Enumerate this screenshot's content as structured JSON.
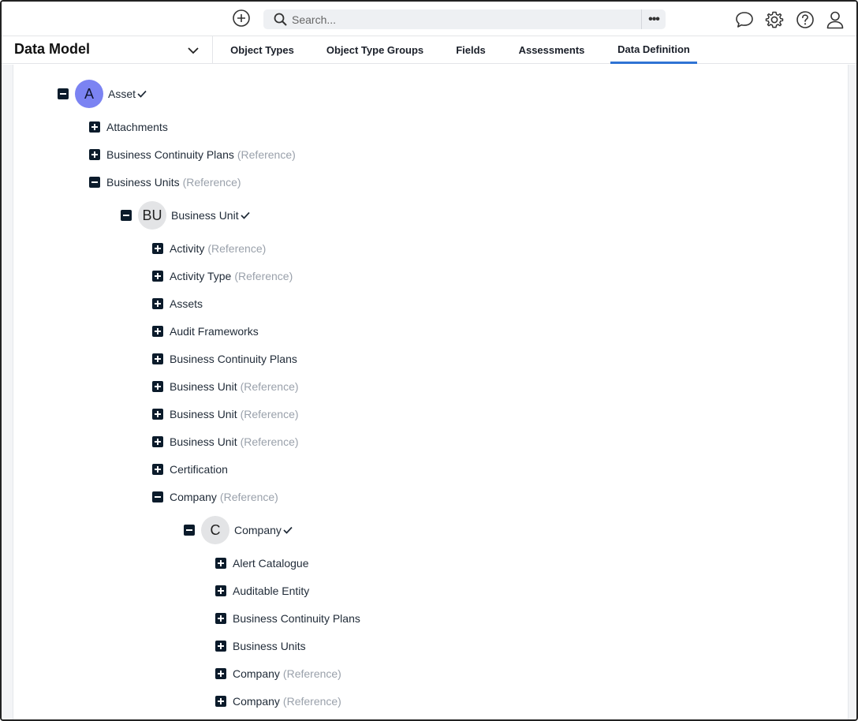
{
  "topbar": {
    "search_placeholder": "Search...",
    "more_label": "•••",
    "icons": [
      "add-circle-icon",
      "search-icon",
      "chat-icon",
      "gear-icon",
      "help-icon",
      "user-icon"
    ]
  },
  "nav": {
    "selector_title": "Data Model",
    "tabs": [
      {
        "label": "Object Types"
      },
      {
        "label": "Object Type Groups"
      },
      {
        "label": "Fields"
      },
      {
        "label": "Assessments"
      },
      {
        "label": "Data Definition",
        "active": true
      }
    ]
  },
  "colors": {
    "accent": "#2f73d4",
    "avatar_primary": "#7b83f2",
    "avatar_secondary": "#e3e4e6",
    "toggle": "#0b1b2b",
    "reference_text": "#9aa1ab"
  },
  "tree": {
    "root": {
      "initials": "A",
      "name": "Asset"
    },
    "level1": [
      {
        "label": "Attachments",
        "ref": "",
        "expanded": false
      },
      {
        "label": "Business Continuity Plans",
        "ref": "(Reference)",
        "expanded": false
      },
      {
        "label": "Business Units",
        "ref": "(Reference)",
        "expanded": true
      }
    ],
    "node2": {
      "initials": "BU",
      "name": "Business Unit"
    },
    "level2": [
      {
        "label": "Activity",
        "ref": "(Reference)",
        "expanded": false
      },
      {
        "label": "Activity Type",
        "ref": "(Reference)",
        "expanded": false
      },
      {
        "label": "Assets",
        "ref": "",
        "expanded": false
      },
      {
        "label": "Audit Frameworks",
        "ref": "",
        "expanded": false
      },
      {
        "label": "Business Continuity Plans",
        "ref": "",
        "expanded": false
      },
      {
        "label": "Business Unit",
        "ref": "(Reference)",
        "expanded": false
      },
      {
        "label": "Business Unit",
        "ref": "(Reference)",
        "expanded": false
      },
      {
        "label": "Business Unit",
        "ref": "(Reference)",
        "expanded": false
      },
      {
        "label": "Certification",
        "ref": "",
        "expanded": false
      },
      {
        "label": "Company",
        "ref": "(Reference)",
        "expanded": true
      }
    ],
    "node3": {
      "initials": "C",
      "name": "Company"
    },
    "level3": [
      {
        "label": "Alert Catalogue",
        "ref": "",
        "expanded": false
      },
      {
        "label": "Auditable Entity",
        "ref": "",
        "expanded": false
      },
      {
        "label": "Business Continuity Plans",
        "ref": "",
        "expanded": false
      },
      {
        "label": "Business Units",
        "ref": "",
        "expanded": false
      },
      {
        "label": "Company",
        "ref": "(Reference)",
        "expanded": false
      },
      {
        "label": "Company",
        "ref": "(Reference)",
        "expanded": false
      }
    ]
  }
}
